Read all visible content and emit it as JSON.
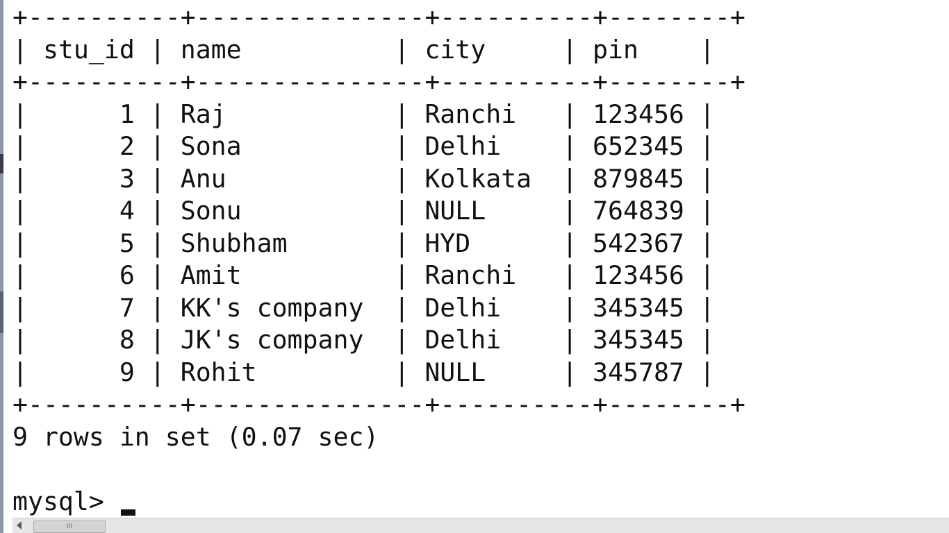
{
  "terminal": {
    "table": {
      "border": "+----------+---------------+----------+--------+",
      "header": "| stu_id | name          | city     | pin    |",
      "rows": [
        "|      1 | Raj           | Ranchi   | 123456 |",
        "|      2 | Sona          | Delhi    | 652345 |",
        "|      3 | Anu           | Kolkata  | 879845 |",
        "|      4 | Sonu          | NULL     | 764839 |",
        "|      5 | Shubham       | HYD      | 542367 |",
        "|      6 | Amit          | Ranchi   | 123456 |",
        "|      7 | KK's company  | Delhi    | 345345 |",
        "|      8 | JK's company  | Delhi    | 345345 |",
        "|      9 | Rohit         | NULL     | 345787 |"
      ]
    },
    "result_summary": "9 rows in set (0.07 sec)",
    "prompt": "mysql> "
  },
  "scrollbar": {
    "thumb_grip": "III",
    "left_arrow_icon": "arrow-left-icon"
  }
}
